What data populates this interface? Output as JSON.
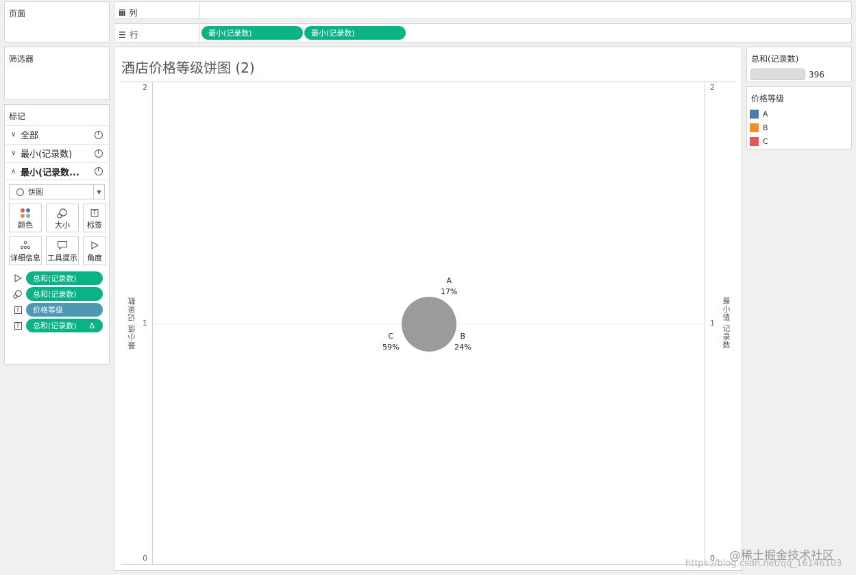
{
  "left": {
    "pages_title": "页面",
    "filters_title": "筛选器",
    "marks": {
      "title": "标记",
      "rows": [
        {
          "chevron": "∨",
          "label": "全部"
        },
        {
          "chevron": "∨",
          "label": "最小(记录数)"
        },
        {
          "chevron": "∧",
          "label": "最小(记录数..."
        }
      ],
      "mark_type": "饼图",
      "tiles": {
        "color": "颜色",
        "size": "大小",
        "label": "标签",
        "detail": "详细信息",
        "tooltip": "工具提示",
        "angle": "角度"
      },
      "pills": [
        {
          "label": "总和(记录数)"
        },
        {
          "label": "总和(记录数)"
        },
        {
          "label": "价格等级"
        },
        {
          "label": "总和(记录数)",
          "suffix": "Δ"
        }
      ]
    }
  },
  "shelves": {
    "columns_label": "列",
    "rows_label": "行",
    "row_pills": [
      "最小(记录数)",
      "最小(记录数)"
    ]
  },
  "chart": {
    "title": "酒店价格等级饼图 (2)",
    "axis_title": "最小值 记录数",
    "ticks_left": [
      "2",
      "1",
      "0"
    ],
    "ticks_right": [
      "2",
      "1",
      "0"
    ],
    "pie_labels": [
      {
        "name": "A",
        "pct": "17%"
      },
      {
        "name": "B",
        "pct": "24%"
      },
      {
        "name": "C",
        "pct": "59%"
      }
    ],
    "pie_color": "#9b9b9b"
  },
  "chart_data": {
    "type": "pie",
    "title": "酒店价格等级饼图 (2)",
    "ylabel": "最小值 记录数",
    "ylim": [
      0,
      2
    ],
    "y_ticks": [
      0,
      1,
      2
    ],
    "categories": [
      "A",
      "B",
      "C"
    ],
    "values": [
      17,
      24,
      59
    ],
    "value_unit": "%"
  },
  "legends": {
    "size": {
      "title": "总和(记录数)",
      "value": "396"
    },
    "color": {
      "title": "价格等级",
      "items": [
        {
          "label": "A",
          "color": "#4e79a7"
        },
        {
          "label": "B",
          "color": "#f28e2b"
        },
        {
          "label": "C",
          "color": "#e15759"
        }
      ]
    }
  },
  "watermark": {
    "text": "@稀土掘金技术社区",
    "url": "https://blog.csdn.net/qq_16146103"
  }
}
